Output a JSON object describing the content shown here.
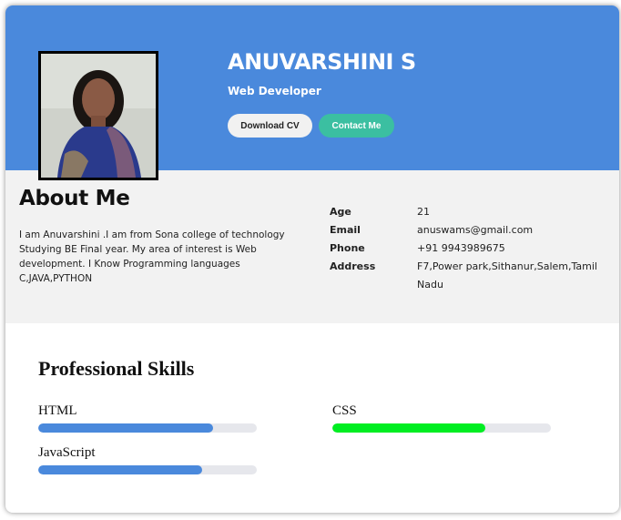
{
  "profile": {
    "name": "ANUVARSHINI S",
    "role": "Web Developer",
    "download_label": "Download CV",
    "contact_label": "Contact Me"
  },
  "about": {
    "title": "About Me",
    "text": "I am Anuvarshini .I am from Sona college of technology Studying BE Final year. My area of interest is Web development. I Know Programming languages C,JAVA,PYTHON",
    "details": [
      {
        "label": "Age",
        "value": "21"
      },
      {
        "label": "Email",
        "value": "anuswams@gmail.com"
      },
      {
        "label": "Phone",
        "value": "+91 9943989675"
      },
      {
        "label": "Address",
        "value": "F7,Power park,Sithanur,Salem,Tamil Nadu"
      }
    ]
  },
  "skills": {
    "title": "Professional Skills",
    "items": [
      {
        "name": "HTML",
        "level": 0.8,
        "color": "#4a89dc"
      },
      {
        "name": "CSS",
        "level": 0.7,
        "color": "#00ee22"
      },
      {
        "name": "JavaScript",
        "level": 0.75,
        "color": "#4a89dc"
      }
    ]
  },
  "colors": {
    "header": "#4a89dc",
    "contact_button": "#3bbfa1",
    "about_bg": "#f2f2f2"
  }
}
